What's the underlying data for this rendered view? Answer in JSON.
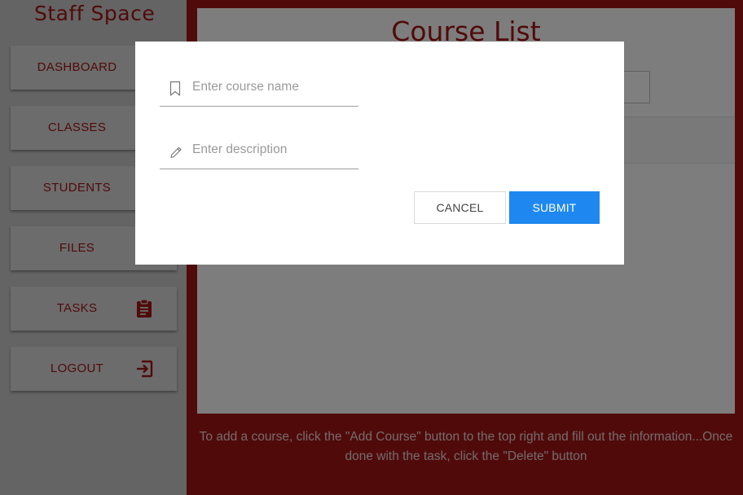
{
  "sidebar": {
    "brand": "Staff Space",
    "items": [
      {
        "label": "DASHBOARD",
        "icon": "dashboard-icon"
      },
      {
        "label": "CLASSES",
        "icon": "classes-icon"
      },
      {
        "label": "STUDENTS",
        "icon": "students-icon"
      },
      {
        "label": "FILES",
        "icon": "files-icon"
      },
      {
        "label": "TASKS",
        "icon": "clipboard-icon"
      },
      {
        "label": "LOGOUT",
        "icon": "logout-icon"
      }
    ]
  },
  "main": {
    "title": "Course List",
    "instructions": "To add a course, click the \"Add Course\" button to the top right and fill out the information...Once done with the task, click the \"Delete\" button"
  },
  "dialog": {
    "course_name_placeholder": "Enter course name",
    "description_placeholder": "Enter description",
    "cancel_label": "CANCEL",
    "submit_label": "SUBMIT"
  },
  "colors": {
    "brand_red": "#a31515",
    "submit_blue": "#1e88f0",
    "sidebar_bg": "#c8c8c8"
  }
}
